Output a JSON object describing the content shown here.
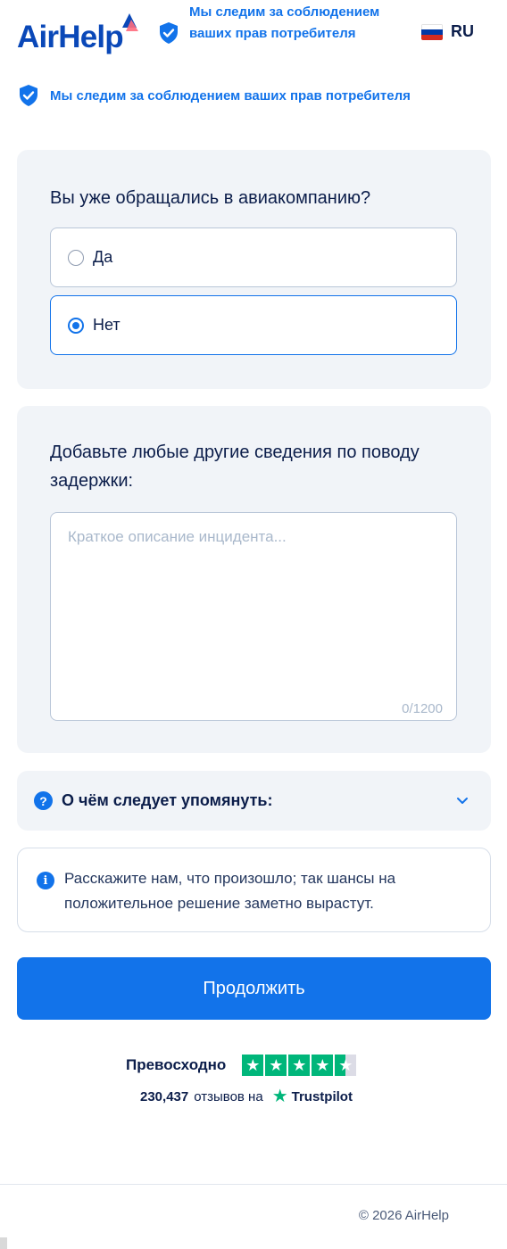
{
  "header": {
    "logo_text": "AirHelp",
    "claim": "Мы следим за соблюдением ваших прав потребителя",
    "language": "RU",
    "flag_colors": [
      "#ffffff",
      "#0039a6",
      "#d52b1e"
    ]
  },
  "claim_row": {
    "text": "Мы следим за соблюдением ваших прав потребителя",
    "icon": "shield-check-icon"
  },
  "question1": {
    "title": "Вы уже обращались в авиакомпанию?",
    "options": [
      {
        "label": "Да",
        "selected": false
      },
      {
        "label": "Нет",
        "selected": true
      }
    ]
  },
  "question2": {
    "title": "Добавьте любые другие сведения по поводу задержки:",
    "placeholder": "Краткое описание инцидента...",
    "value": "",
    "counter": "0/1200"
  },
  "accordion": {
    "icon": "help-circle-icon",
    "label": "О чём следует упомянуть:",
    "expanded": false
  },
  "info": {
    "icon": "info-icon",
    "text": "Расскажите нам, что произошло; так шансы на положительное решение заметно вырастут."
  },
  "continue_button": "Продолжить",
  "trustpilot": {
    "rating_text": "Превосходно",
    "stars": 4.5,
    "review_count": "230,437",
    "reviews_on": "отзывов на",
    "brand": "Trustpilot"
  },
  "footer": {
    "copyright": "© 2026 AirHelp"
  },
  "colors": {
    "accent": "#1273ea",
    "brand_dark": "#0a48b8",
    "card_bg": "#f1f4f8",
    "trustpilot_green": "#00b67a"
  }
}
